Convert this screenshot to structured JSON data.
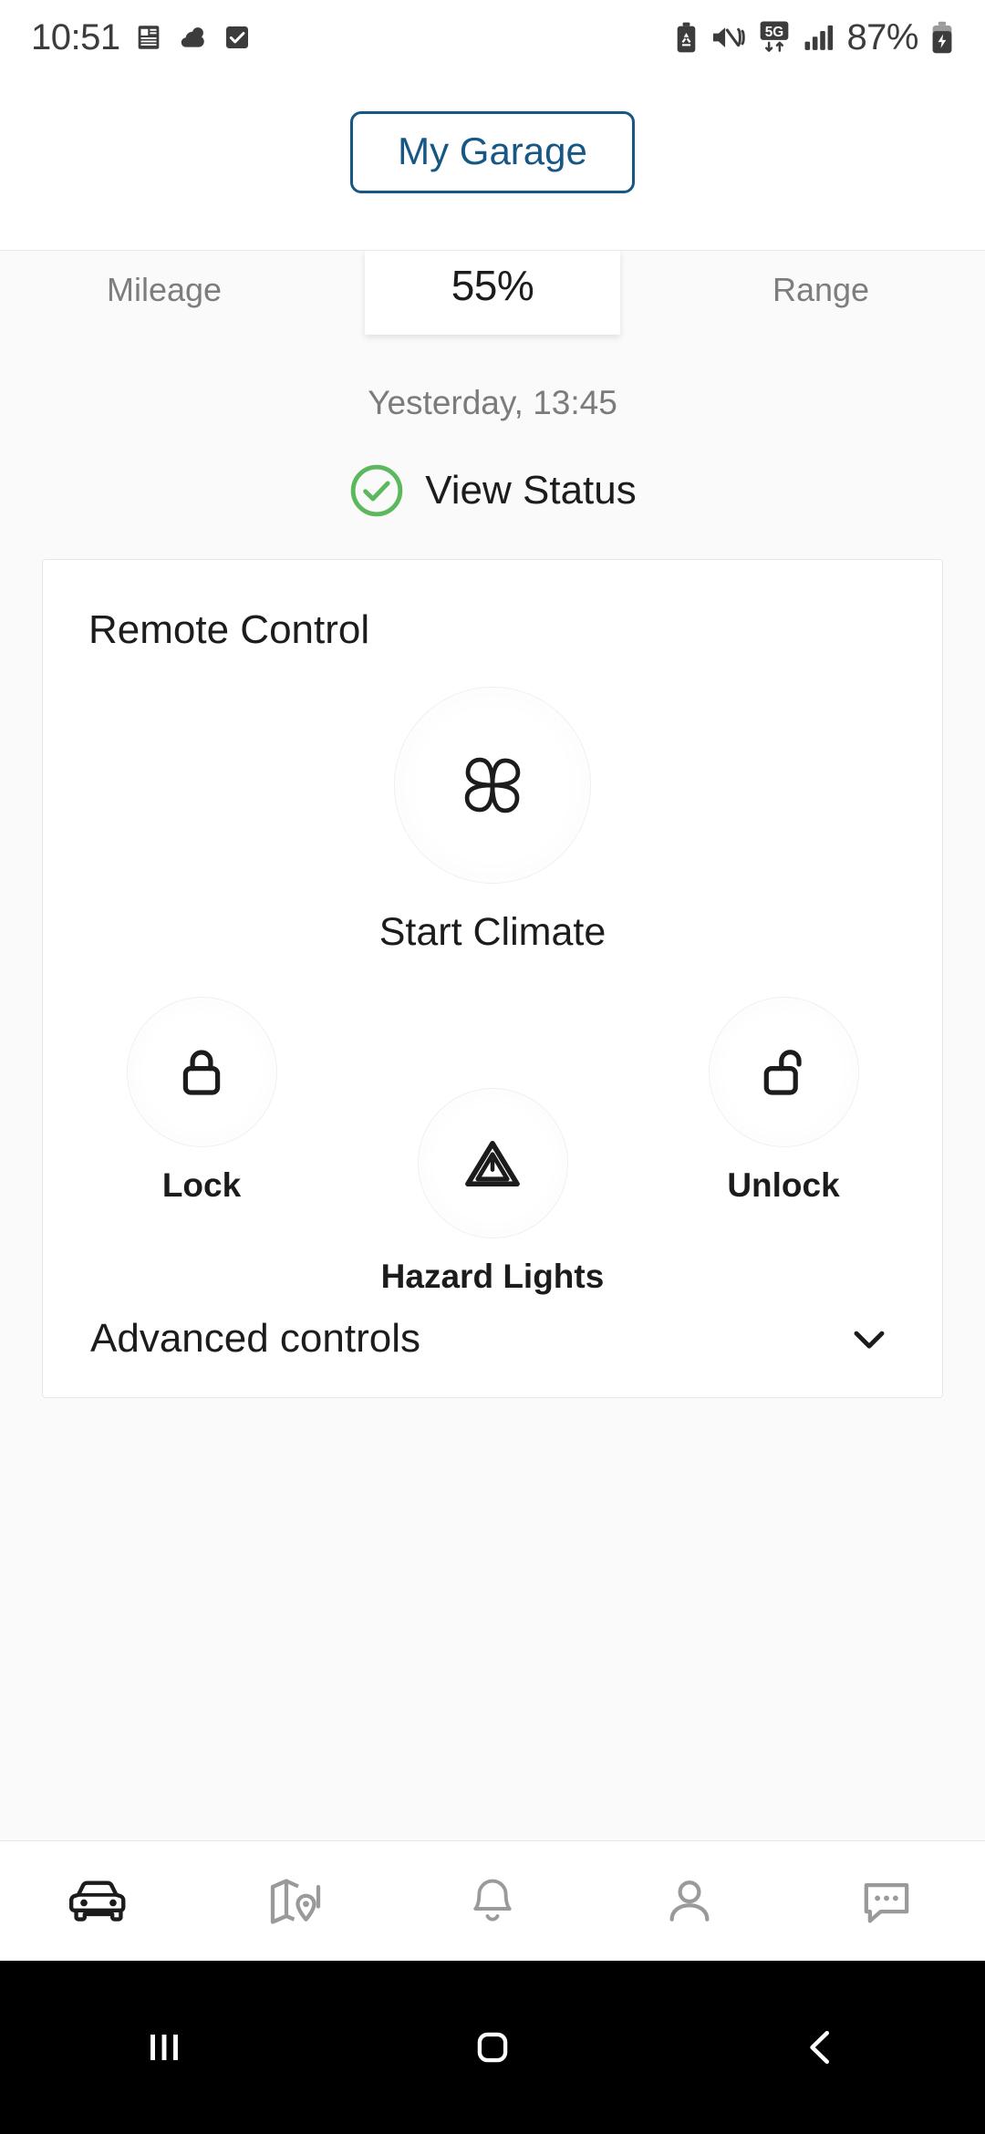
{
  "status_bar": {
    "time": "10:51",
    "battery_percent": "87%",
    "left_icons": [
      "calculator-icon",
      "weather-cloud-icon",
      "checkbox-checked-icon"
    ],
    "right_icons": [
      "battery-saver-icon",
      "mute-vibrate-icon",
      "5g-network-icon",
      "signal-bars-icon",
      "charging-battery-icon"
    ],
    "network_label": "5G"
  },
  "header": {
    "garage_button_label": "My Garage",
    "accent_color": "#175784"
  },
  "vehicle_stats": {
    "mileage_label": "Mileage",
    "battery_value": "55%",
    "range_label": "Range",
    "timestamp": "Yesterday, 13:45",
    "view_status_label": "View Status",
    "status_ok_color": "#5cb85c"
  },
  "remote_control": {
    "title": "Remote Control",
    "climate": {
      "label": "Start Climate",
      "icon": "fan-climate-icon"
    },
    "lock": {
      "label": "Lock",
      "icon": "lock-closed-icon"
    },
    "unlock": {
      "label": "Unlock",
      "icon": "lock-open-icon"
    },
    "hazard": {
      "label": "Hazard Lights",
      "icon": "hazard-triangle-icon"
    },
    "advanced": {
      "label": "Advanced controls",
      "icon": "chevron-down-icon"
    }
  },
  "bottom_nav": {
    "items": [
      {
        "name": "vehicle",
        "icon": "car-icon",
        "active": true
      },
      {
        "name": "map",
        "icon": "map-pin-icon",
        "active": false
      },
      {
        "name": "notifications",
        "icon": "bell-icon",
        "active": false
      },
      {
        "name": "profile",
        "icon": "person-icon",
        "active": false
      },
      {
        "name": "messages",
        "icon": "chat-bubble-icon",
        "active": false
      }
    ],
    "active_color": "#1c1c1c",
    "inactive_color": "#9a9a9a"
  },
  "system_nav": {
    "recents": "recents-icon",
    "home": "home-icon",
    "back": "back-icon"
  }
}
